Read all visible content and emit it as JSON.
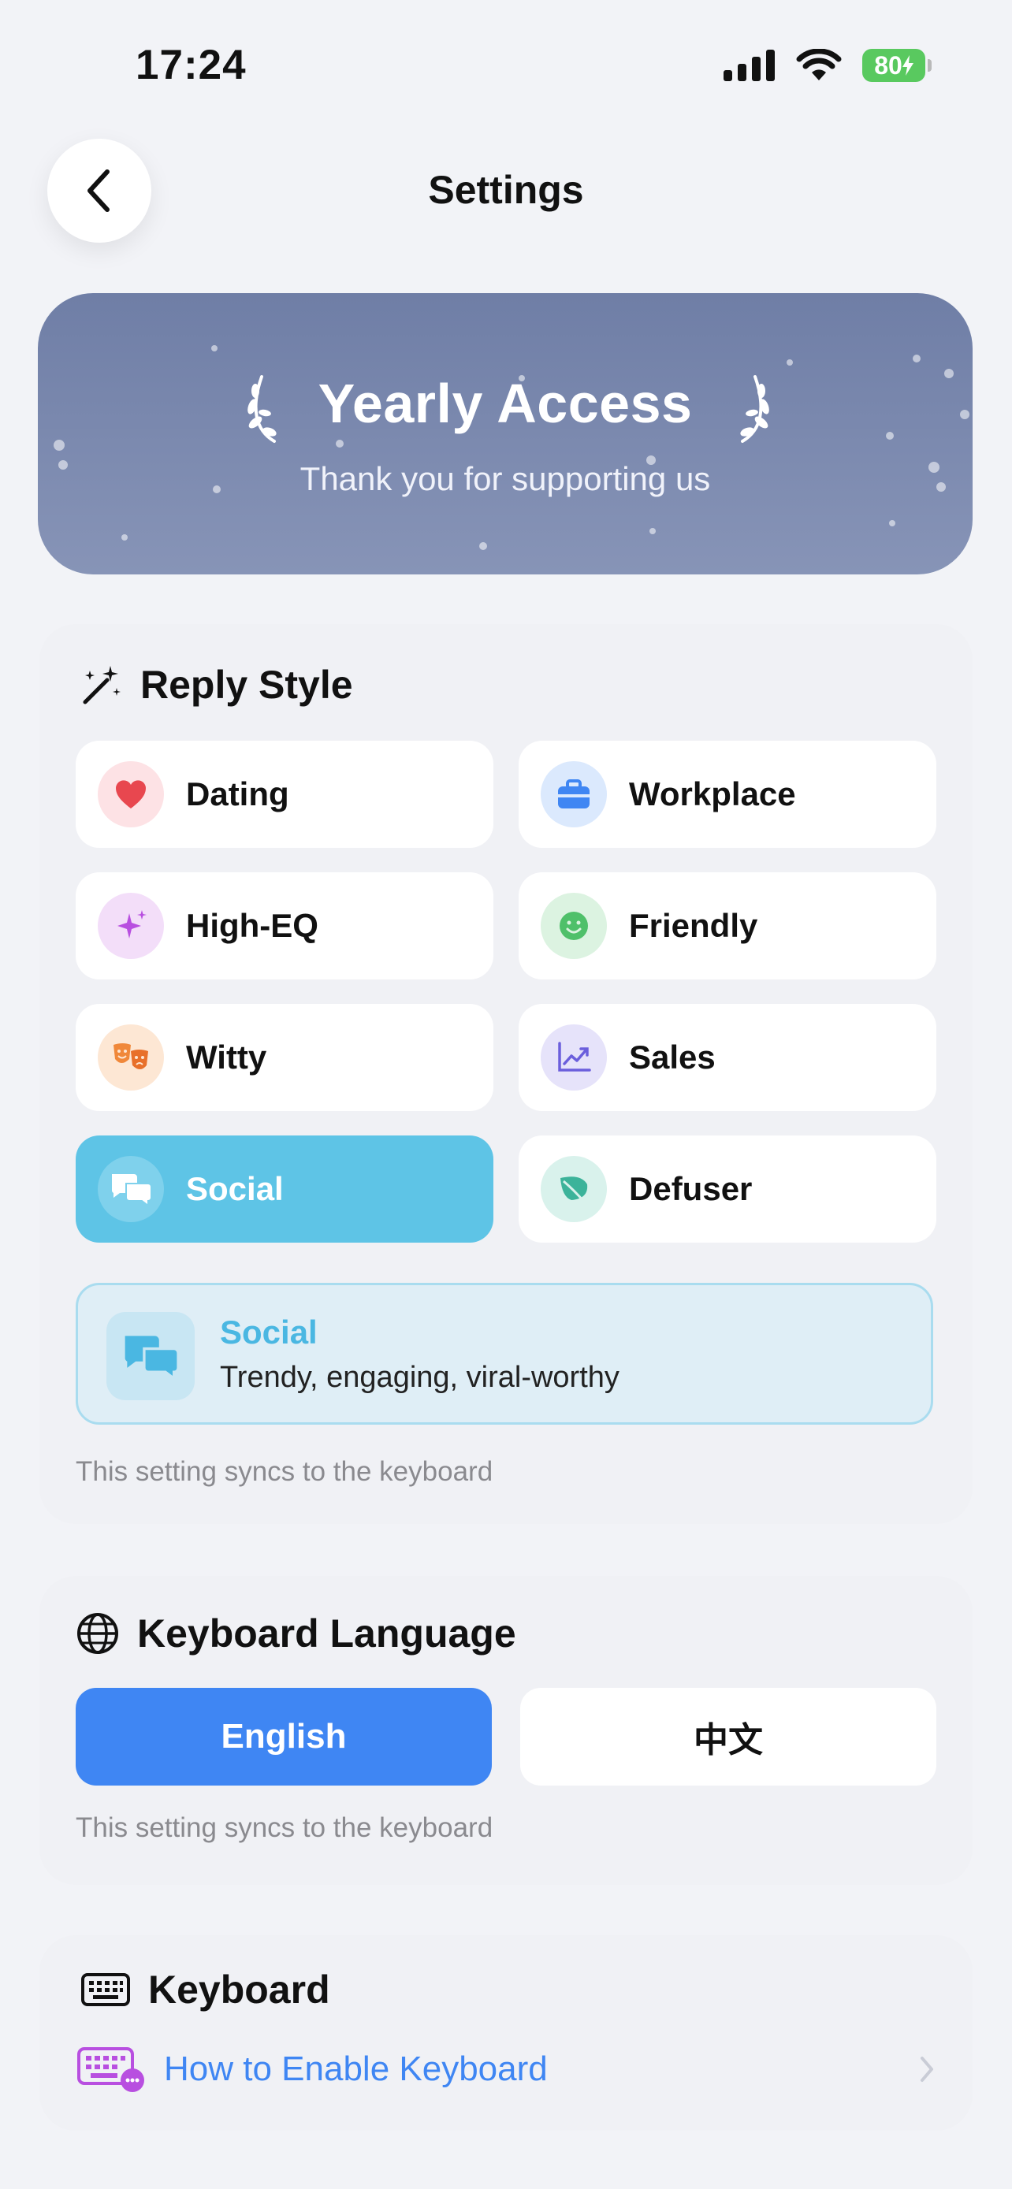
{
  "status_bar": {
    "time": "17:24",
    "battery_level": "80"
  },
  "nav": {
    "title": "Settings"
  },
  "banner": {
    "title": "Yearly Access",
    "subtitle": "Thank you for supporting us"
  },
  "reply_style": {
    "heading": "Reply Style",
    "options": [
      {
        "label": "Dating",
        "icon": "heart-icon",
        "color": "#e8474f",
        "bg": "#fde2e5"
      },
      {
        "label": "Workplace",
        "icon": "briefcase-icon",
        "color": "#3f86f3",
        "bg": "#dbe9fd"
      },
      {
        "label": "High-EQ",
        "icon": "sparkles-icon",
        "color": "#b84fe0",
        "bg": "#f3def9"
      },
      {
        "label": "Friendly",
        "icon": "smile-icon",
        "color": "#4fc06a",
        "bg": "#dcf3e1"
      },
      {
        "label": "Witty",
        "icon": "masks-icon",
        "color": "#f0883a",
        "bg": "#fde7d4"
      },
      {
        "label": "Sales",
        "icon": "chart-icon",
        "color": "#6b5fdc",
        "bg": "#e6e3fa"
      },
      {
        "label": "Social",
        "icon": "chat-bubbles-icon",
        "color": "#ffffff",
        "bg": "#7fd1ec",
        "active": true
      },
      {
        "label": "Defuser",
        "icon": "leaf-icon",
        "color": "#3cb39a",
        "bg": "#d9f2ec"
      }
    ],
    "selected": {
      "title": "Social",
      "description": "Trendy, engaging, viral-worthy"
    },
    "sync_note": "This setting syncs to the keyboard"
  },
  "keyboard_language": {
    "heading": "Keyboard Language",
    "options": [
      "English",
      "中文"
    ],
    "selected": "English",
    "sync_note": "This setting syncs to the keyboard"
  },
  "keyboard": {
    "heading": "Keyboard",
    "link_label": "How to Enable Keyboard"
  },
  "colors": {
    "accent": "#3f86f3",
    "active_style": "#5ec4e6",
    "background": "#f2f3f7"
  }
}
